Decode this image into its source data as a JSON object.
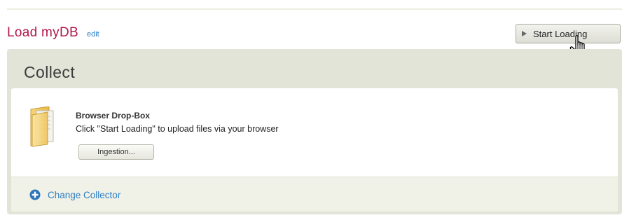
{
  "header": {
    "title": "Load myDB",
    "edit_label": "edit",
    "start_button_label": "Start Loading"
  },
  "panel": {
    "title": "Collect",
    "collector": {
      "icon": "folder-icon",
      "name": "Browser Drop-Box",
      "description": "Click \"Start Loading\" to upload files via your browser",
      "ingest_button_label": "Ingestion..."
    },
    "change_collector_label": "Change Collector"
  },
  "colors": {
    "title": "#b0184e",
    "link": "#2e7fc4",
    "panel_bg": "#e3e4d8"
  }
}
